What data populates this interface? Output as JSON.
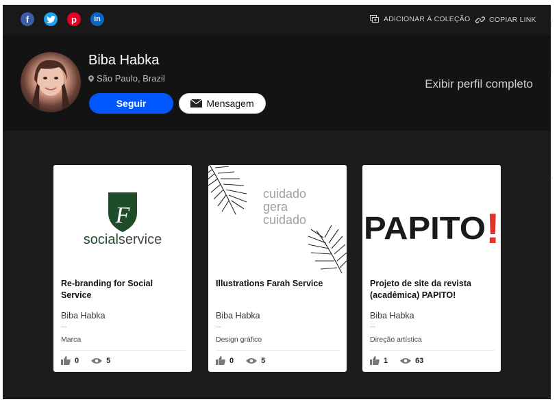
{
  "share": {
    "icons": [
      "facebook-icon",
      "twitter-icon",
      "pinterest-icon",
      "linkedin-icon"
    ],
    "add_collection": "ADICIONAR À COLEÇÃO",
    "copy_link": "COPIAR LINK"
  },
  "profile": {
    "name": "Biba Habka",
    "location": "São Paulo, Brazil",
    "follow": "Seguir",
    "message": "Mensagem",
    "full_profile": "Exibir perfil completo"
  },
  "projects": [
    {
      "title": "Re-branding for Social Service",
      "author": "Biba Habka",
      "category": "Marca",
      "likes": "0",
      "views": "5",
      "cover": {
        "brand_left": "social",
        "brand_right": "service",
        "monogram": "F",
        "color": "#1f4d2a"
      }
    },
    {
      "title": "Illustrations Farah Service",
      "author": "Biba Habka",
      "category": "Design gráfico",
      "likes": "0",
      "views": "5",
      "cover": {
        "lines": [
          "cuidado",
          "gera",
          "cuidado"
        ]
      }
    },
    {
      "title": "Projeto de site da revista (acadêmica) PAPITO!",
      "author": "Biba Habka",
      "category": "Direção artística",
      "likes": "1",
      "views": "63",
      "cover": {
        "wordmark": "PAPITO",
        "accent": "!",
        "accent_color": "#e0342c"
      }
    }
  ],
  "colors": {
    "accent": "#0057ff",
    "frame": "#1c1c1c"
  }
}
